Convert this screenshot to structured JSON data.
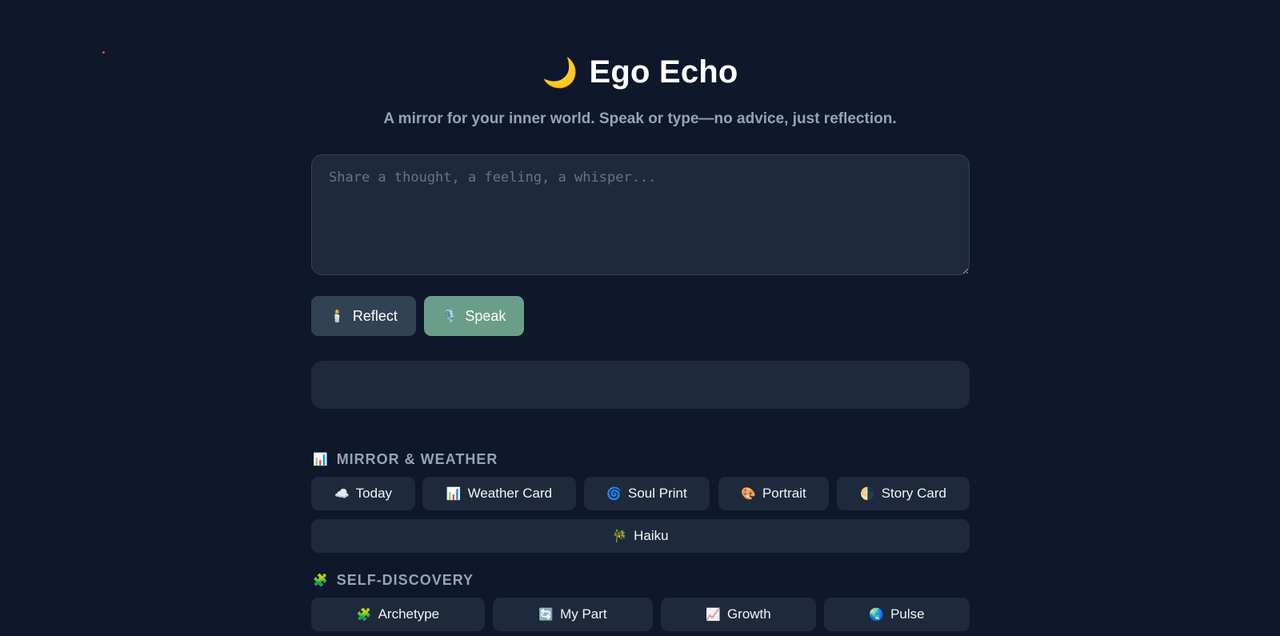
{
  "header": {
    "title_icon": "🌙",
    "title": "Ego Echo",
    "subtitle": "A mirror for your inner world. Speak or type—no advice, just reflection."
  },
  "input": {
    "placeholder": "Share a thought, a feeling, a whisper...",
    "value": ""
  },
  "actions": {
    "reflect_icon": "🕯️",
    "reflect_label": "Reflect",
    "speak_icon": "🎙️",
    "speak_label": "Speak"
  },
  "sections": {
    "mirror": {
      "icon": "📊",
      "title": "MIRROR & WEATHER",
      "chips": [
        {
          "icon": "☁️",
          "label": "Today"
        },
        {
          "icon": "📊",
          "label": "Weather Card"
        },
        {
          "icon": "🌀",
          "label": "Soul Print"
        },
        {
          "icon": "🎨",
          "label": "Portrait"
        },
        {
          "icon": "🌗",
          "label": "Story Card"
        },
        {
          "icon": "🎋",
          "label": "Haiku"
        }
      ]
    },
    "self": {
      "icon": "🧩",
      "title": "SELF-DISCOVERY",
      "chips": [
        {
          "icon": "🧩",
          "label": "Archetype"
        },
        {
          "icon": "🔄",
          "label": "My Part"
        },
        {
          "icon": "📈",
          "label": "Growth"
        },
        {
          "icon": "🌏",
          "label": "Pulse"
        }
      ]
    }
  },
  "colors": {
    "background": "#0f172a",
    "panel": "#1e293b",
    "reflect_button": "#334155",
    "speak_button": "#6b9e8a",
    "muted_text": "#94a3b8"
  }
}
